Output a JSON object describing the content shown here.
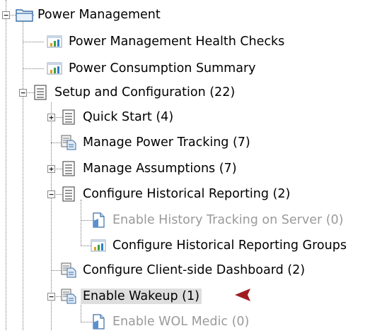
{
  "tree": {
    "root": {
      "label": "Power Management",
      "icon": "folder-icon"
    },
    "items": [
      {
        "label": "Power Management Health Checks",
        "icon": "report-chart-icon"
      },
      {
        "label": "Power Consumption Summary",
        "icon": "report-chart-icon"
      },
      {
        "label": "Setup and Configuration (22)",
        "icon": "list-icon"
      },
      {
        "label": "Quick Start (4)",
        "icon": "list-icon"
      },
      {
        "label": "Manage Power Tracking (7)",
        "icon": "policy-doc-icon"
      },
      {
        "label": "Manage Assumptions (7)",
        "icon": "list-icon"
      },
      {
        "label": "Configure Historical Reporting (2)",
        "icon": "list-icon"
      },
      {
        "label": "Enable History Tracking on Server (0)",
        "icon": "document-icon"
      },
      {
        "label": "Configure Historical Reporting Groups",
        "icon": "report-chart-icon"
      },
      {
        "label": "Configure Client-side Dashboard (2)",
        "icon": "policy-doc-icon"
      },
      {
        "label": "Enable Wakeup (1)",
        "icon": "policy-doc-icon"
      },
      {
        "label": "Enable WOL Medic (0)",
        "icon": "document-icon"
      }
    ]
  },
  "colors": {
    "arrow": "#c0262a",
    "selection": "#dedede",
    "muted_text": "#9a9a9a"
  }
}
